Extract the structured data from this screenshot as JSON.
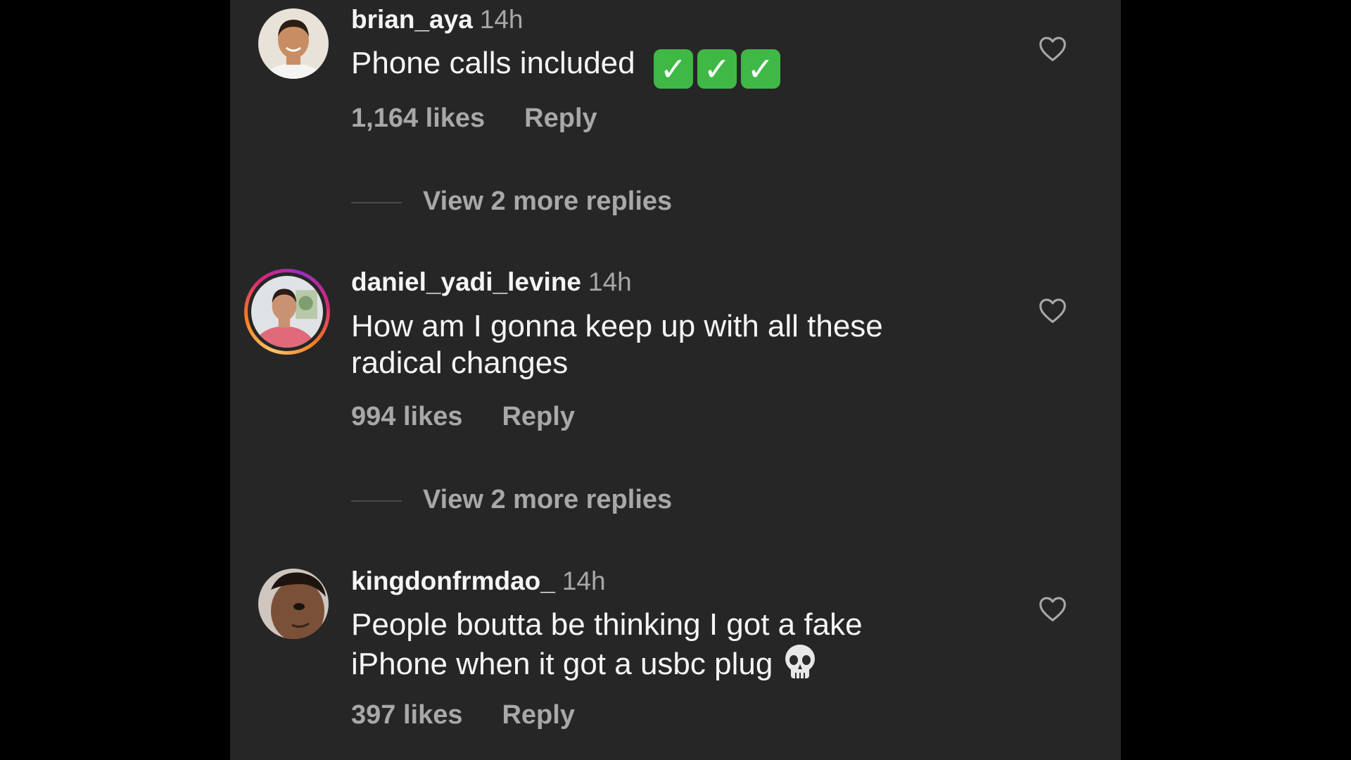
{
  "comments": [
    {
      "username": "brian_aya",
      "time": "14h",
      "text": "Phone calls included",
      "emoji": [
        "✓",
        "✓",
        "✓"
      ],
      "emoji_name": "white-heavy-check-mark",
      "likes": "1,164 likes",
      "reply": "Reply",
      "view_more": "View 2 more replies"
    },
    {
      "username": "daniel_yadi_levine",
      "time": "14h",
      "text": "How am I gonna keep up with all these radical changes",
      "likes": "994 likes",
      "reply": "Reply",
      "view_more": "View 2 more replies"
    },
    {
      "username": "kingdonfrmdao_",
      "time": "14h",
      "text": "People boutta be thinking I got a fake iPhone when it got a usbc plug",
      "emoji_name": "skull",
      "likes": "397 likes",
      "reply": "Reply"
    }
  ],
  "icons": {
    "like": "heart-outline-icon"
  },
  "colors": {
    "panel_background": "#262626",
    "outer_background": "#000000",
    "primary_text": "#f5f5f5",
    "secondary_text": "#a8a8a8",
    "check_green": "#3fb845"
  }
}
